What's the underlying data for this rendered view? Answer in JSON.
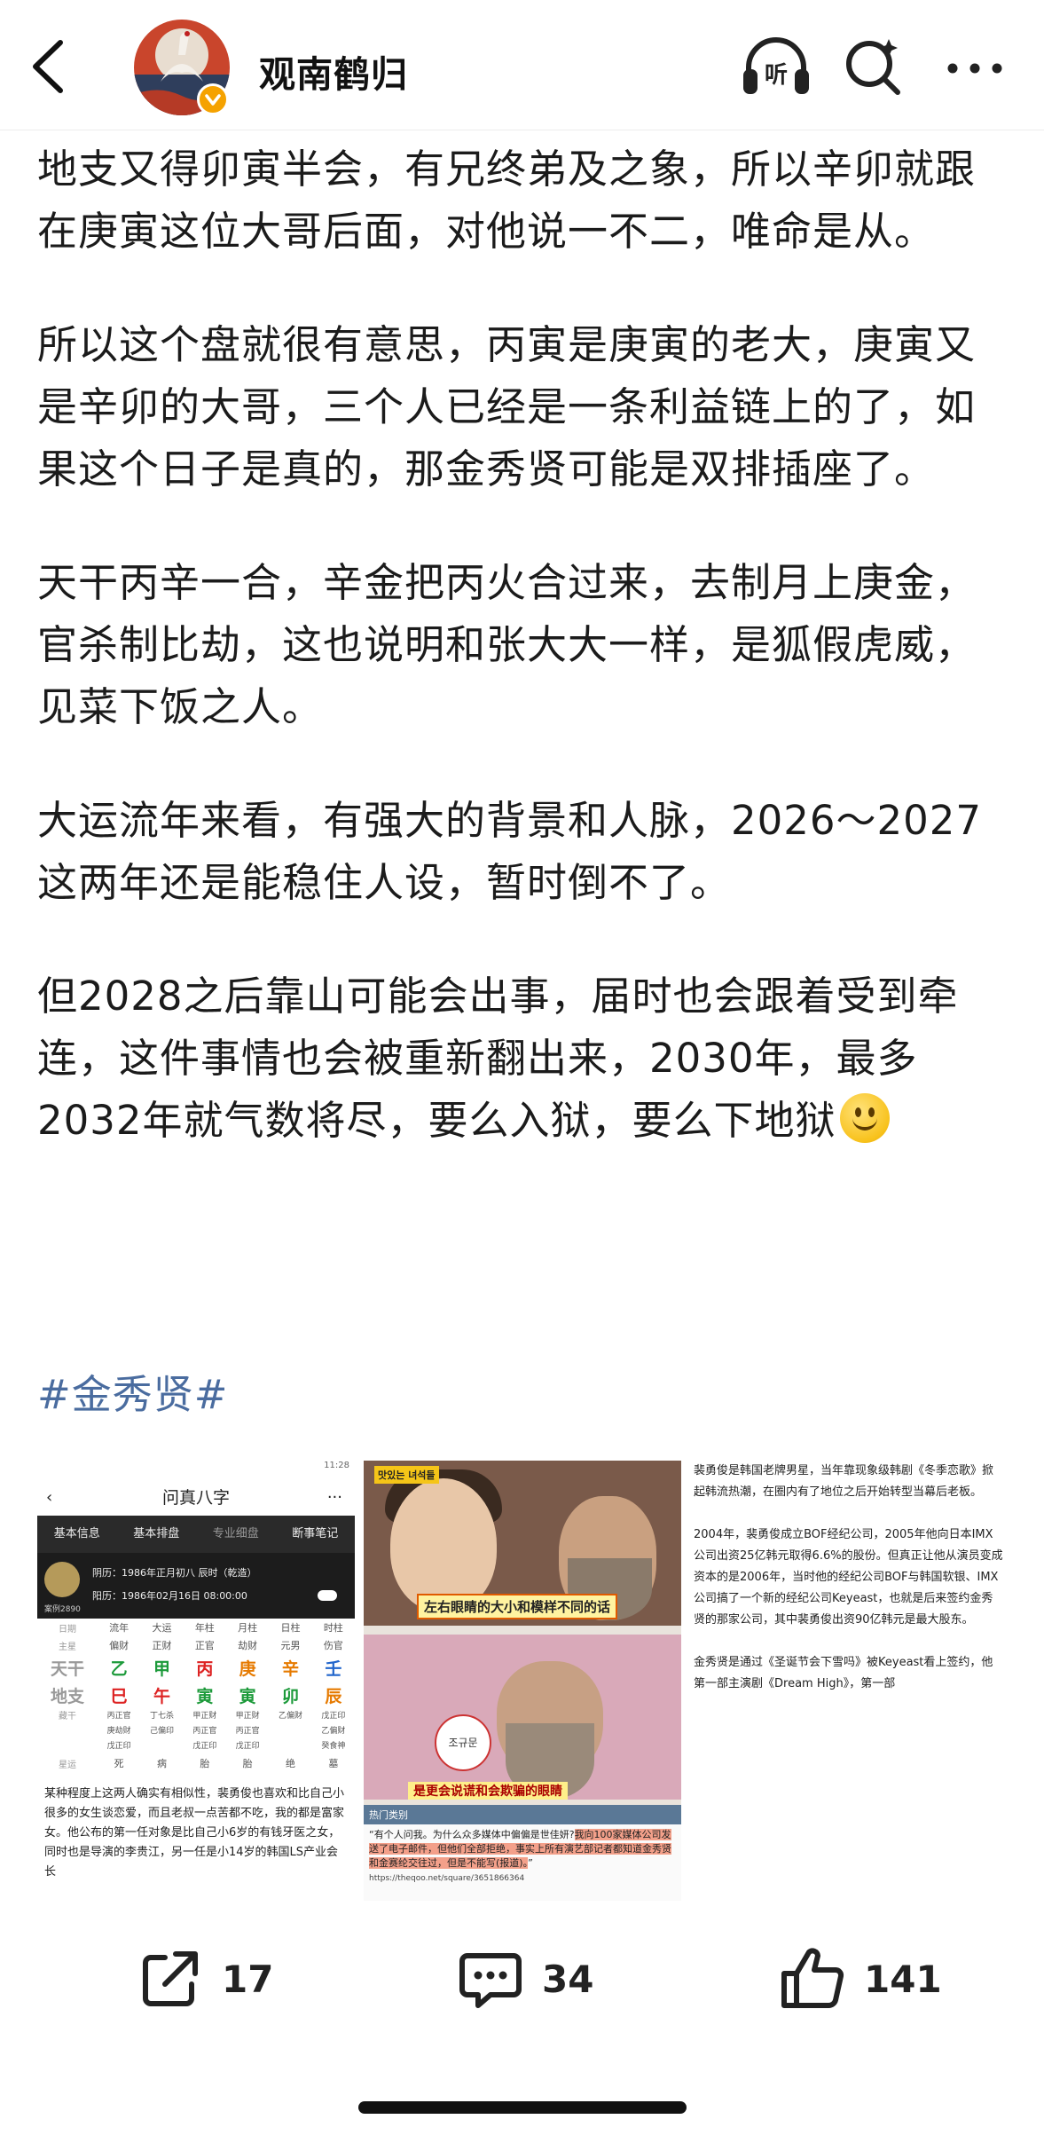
{
  "header": {
    "user_name": "观南鹤归",
    "listen_label": "听"
  },
  "article": {
    "paragraphs": [
      "地支又得卯寅半会，有兄终弟及之象，所以辛卯就跟在庚寅这位大哥后面，对他说一不二，唯命是从。",
      "所以这个盘就很有意思，丙寅是庚寅的老大，庚寅又是辛卯的大哥，三个人已经是一条利益链上的了，如果这个日子是真的，那金秀贤可能是双排插座了。",
      "天干丙辛一合，辛金把丙火合过来，去制月上庚金，官杀制比劫，这也说明和张大大一样，是狐假虎威，见菜下饭之人。",
      "大运流年来看，有强大的背景和人脉，2026～2027这两年还是能稳住人设，暂时倒不了。",
      "但2028之后靠山可能会出事，届时也会跟着受到牵连，这件事情也会被重新翻出来，2030年，最多2032年就气数将尽，要么入狱，要么下地狱"
    ],
    "hashtag": "#金秀贤#"
  },
  "image1": {
    "status": "11:28",
    "title": "问真八字",
    "back": "‹",
    "more": "···",
    "tabs": [
      "基本信息",
      "基本排盘",
      "专业细盘",
      "断事笔记"
    ],
    "lunar": "阴历：1986年正月初八 辰时（乾造）",
    "solar": "阳历：1986年02月16日 08:00:00",
    "case_id": "案例2890",
    "columns": [
      "日期",
      "流年",
      "大运",
      "年柱",
      "月柱",
      "日柱",
      "时柱"
    ],
    "main_star": [
      "主星",
      "偏财",
      "正财",
      "正官",
      "劫财",
      "元男",
      "伤官"
    ],
    "heaven_label": "天干",
    "heaven": [
      "乙",
      "甲",
      "丙",
      "庚",
      "辛",
      "壬"
    ],
    "earth_label": "地支",
    "earth": [
      "巳",
      "午",
      "寅",
      "寅",
      "卯",
      "辰"
    ],
    "hidden_label": "藏干",
    "hidden_row1": [
      "丙正官",
      "丁七杀",
      "甲正财",
      "甲正财",
      "乙偏财",
      "戊正印"
    ],
    "hidden_row2": [
      "庚劫财",
      "己偏印",
      "丙正官",
      "丙正官",
      "",
      "乙偏财"
    ],
    "hidden_row3": [
      "戊正印",
      "",
      "戊正印",
      "戊正印",
      "",
      "癸食神"
    ],
    "stage_label": "星运",
    "stage": [
      "死",
      "病",
      "胎",
      "胎",
      "绝",
      "墓"
    ],
    "caption": "某种程度上这两人确实有相似性，裴勇俊也喜欢和比自己小很多的女生谈恋爱，而且老叔一点苦都不吃，我的都是富家女。他公布的第一任对象是比自己小6岁的有钱牙医之女，同时也是导演的李贵江，另一任是小14岁的韩国LS产业会长"
  },
  "image2": {
    "logo": "맛있는 녀석들",
    "caption_top": "左右眼睛的大小和模样不同的话",
    "nameplate": "조규문",
    "caption_bottom": "是更会说谎和会欺骗的眼睛",
    "news_header": "热门类别",
    "news_text_plain": "“有个人问我。为什么众多媒体中偏偏是世佳妍?",
    "news_text_mark": "我向100家媒体公司发送了电子邮件，但他们全部拒绝，事实上所有演艺部记者都知道金秀贤和金赛纶交往过，但是不能写(报道)。",
    "news_text_end": "”",
    "url": "https://theqoo.net/square/3651866364"
  },
  "image3": {
    "paragraphs": [
      "裴勇俊是韩国老牌男星，当年靠现象级韩剧《冬季恋歌》掀起韩流热潮，在圈内有了地位之后开始转型当幕后老板。",
      "2004年，裴勇俊成立BOF经纪公司，2005年他向日本IMX公司出资25亿韩元取得6.6%的股份。但真正让他从演员变成资本的是2006年，当时他的经纪公司BOF与韩国软银、IMX公司搞了一个新的经纪公司Keyeast，也就是后来签约金秀贤的那家公司，其中裴勇俊出资90亿韩元是最大股东。",
      "金秀贤是通过《圣诞节会下雪吗》被Keyeast看上签约，他第一部主演剧《Dream High》，第一部"
    ]
  },
  "actions": {
    "share_count": "17",
    "comment_count": "34",
    "like_count": "141"
  },
  "colors": {
    "hashtag": "#4a6c9f",
    "verified_badge": "#f5a200",
    "text": "#1b1b1b"
  },
  "icons": [
    "back-arrow-icon",
    "headphone-icon",
    "search-icon",
    "more-icon",
    "share-icon",
    "comment-icon",
    "like-icon"
  ]
}
